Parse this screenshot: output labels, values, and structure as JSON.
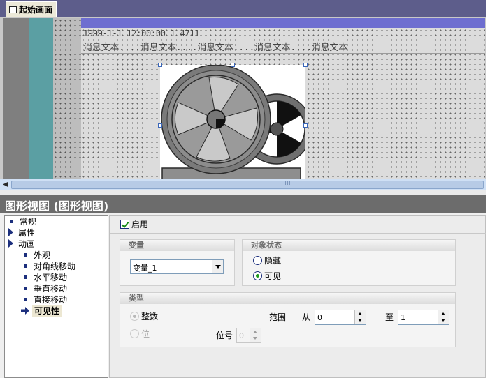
{
  "editor": {
    "tab_label": "起始画面",
    "message_time": "1999-1-1 12:00:00 1 4711",
    "message_text": "消息文本....消息文本....消息文本....消息文本....消息文本"
  },
  "panel": {
    "title": "图形视图 (图形视图)"
  },
  "tree": {
    "items": [
      {
        "label": "常规"
      },
      {
        "label": "属性"
      },
      {
        "label": "动画"
      },
      {
        "label": "外观"
      },
      {
        "label": "对角线移动"
      },
      {
        "label": "水平移动"
      },
      {
        "label": "垂直移动"
      },
      {
        "label": "直接移动"
      },
      {
        "label": "可见性"
      }
    ],
    "selected": "可见性"
  },
  "properties": {
    "enable_label": "启用",
    "enable_checked": true,
    "variable_group": {
      "title": "变量",
      "value": "变量_1"
    },
    "object_state_group": {
      "title": "对象状态",
      "options": [
        "隐藏",
        "可见"
      ],
      "selected": "可见"
    },
    "type_group": {
      "title": "类型",
      "options": [
        "整数",
        "位"
      ],
      "selected": "整数",
      "range_label": "范围",
      "from_label": "从",
      "from_value": "0",
      "to_label": "至",
      "to_value": "1",
      "bit_label": "位号",
      "bit_value": "0"
    }
  }
}
